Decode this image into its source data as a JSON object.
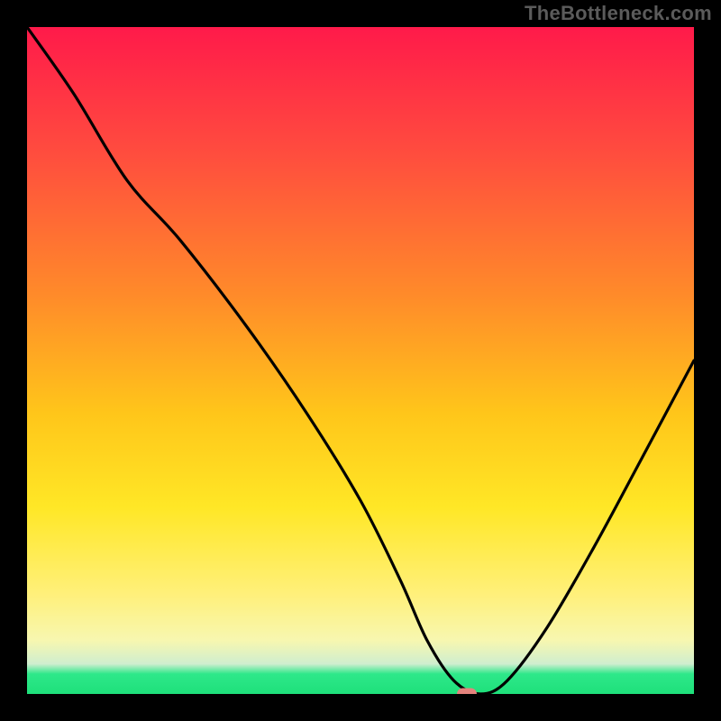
{
  "watermark": "TheBottleneck.com",
  "colors": {
    "frame_bg": "#000000",
    "watermark_text": "#5b5b5b",
    "curve_stroke": "#000000",
    "dot_fill": "#e4837d",
    "gradient_stops": [
      "#ff1a4a",
      "#ff4a3f",
      "#ff8a2a",
      "#ffc61a",
      "#ffe726",
      "#fff07a",
      "#f7f7b0",
      "#cfeecf",
      "#2ee88a",
      "#1ee07a"
    ]
  },
  "chart_data": {
    "type": "line",
    "title": "",
    "xlabel": "",
    "ylabel": "",
    "xlim": [
      0,
      100
    ],
    "ylim": [
      0,
      100
    ],
    "grid": false,
    "legend": false,
    "series": [
      {
        "name": "bottleneck-curve",
        "x": [
          0,
          7,
          15,
          23,
          33,
          42,
          50,
          56,
          60,
          64,
          68,
          72,
          78,
          85,
          92,
          100
        ],
        "y": [
          100,
          90,
          77,
          68,
          55,
          42,
          29,
          17,
          8,
          2,
          0,
          2,
          10,
          22,
          35,
          50
        ]
      }
    ],
    "marker": {
      "x": 66,
      "y": 0
    },
    "note": "x and y are normalized percentages of the plot area; y=0 is the bottom green band, y=100 is the top. Values estimated from pixels; no axis ticks are shown in the image."
  }
}
